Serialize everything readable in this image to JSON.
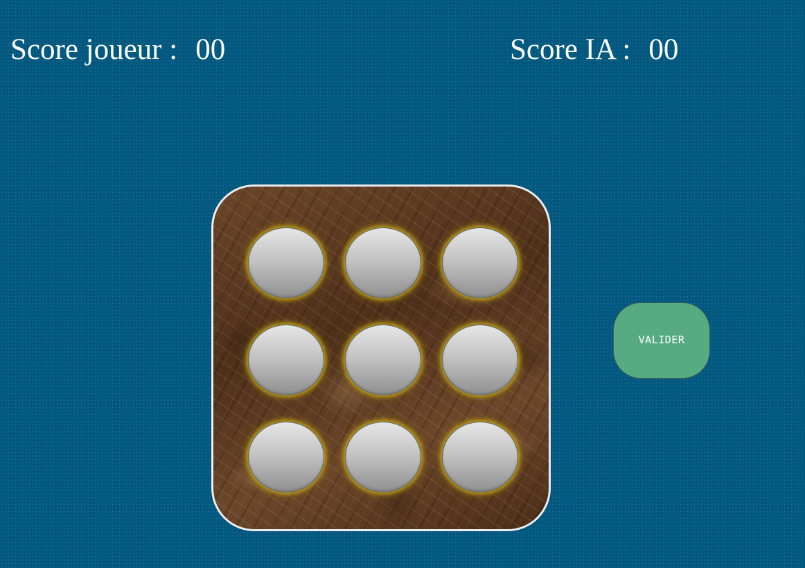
{
  "header": {
    "player_score_label": "Score joueur :",
    "player_score_value": "00",
    "ai_score_label": "Score IA :",
    "ai_score_value": "00"
  },
  "board": {
    "rows": 3,
    "columns": 3,
    "holes": [
      {
        "row": 1,
        "col": 1,
        "state": "empty"
      },
      {
        "row": 1,
        "col": 2,
        "state": "empty"
      },
      {
        "row": 1,
        "col": 3,
        "state": "empty"
      },
      {
        "row": 2,
        "col": 1,
        "state": "empty"
      },
      {
        "row": 2,
        "col": 2,
        "state": "empty"
      },
      {
        "row": 2,
        "col": 3,
        "state": "empty"
      },
      {
        "row": 3,
        "col": 1,
        "state": "empty"
      },
      {
        "row": 3,
        "col": 2,
        "state": "empty"
      },
      {
        "row": 3,
        "col": 3,
        "state": "empty"
      }
    ]
  },
  "actions": {
    "validate_label": "VALIDER"
  },
  "colors": {
    "background": "#02587f",
    "score_text": "#ffffff",
    "board_wood": "#5a3a22",
    "hole_glow": "#c4a61c",
    "validate_button": "#57ab83"
  }
}
